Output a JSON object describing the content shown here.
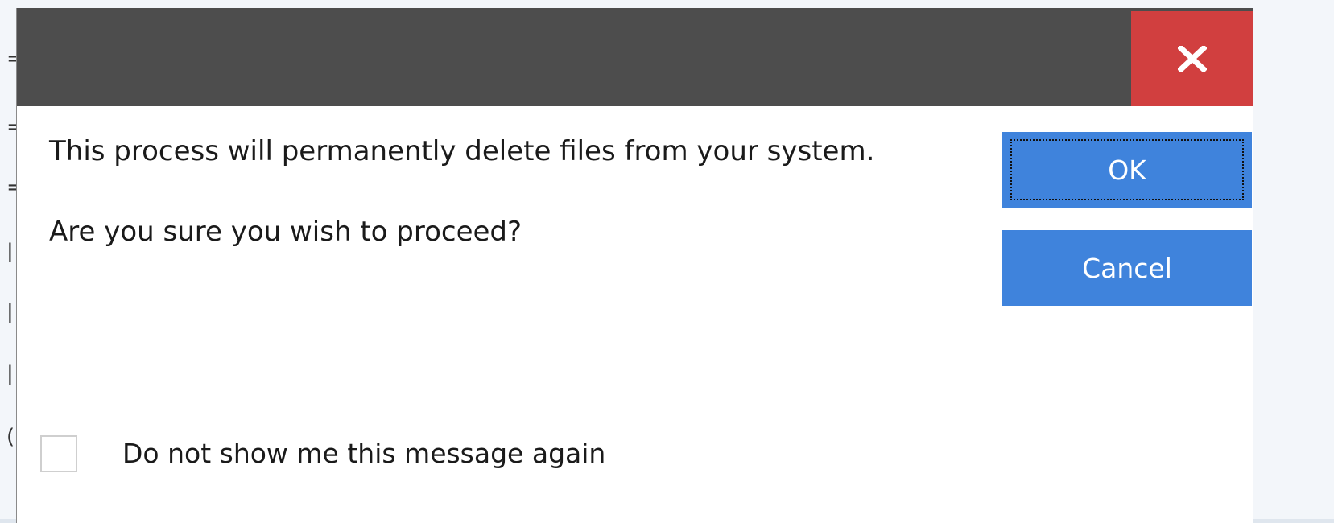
{
  "dialog": {
    "close_icon": "close-icon",
    "message_line_1": "This process will permanently delete files from your system.",
    "message_line_2": "Are you sure you wish to proceed?",
    "ok_label": "OK",
    "cancel_label": "Cancel",
    "checkbox_label": "Do not show me this message again",
    "checkbox_checked": false
  },
  "colors": {
    "titlebar": "#4d4d4d",
    "close_button": "#d13f3f",
    "primary_button": "#3f83dc"
  }
}
